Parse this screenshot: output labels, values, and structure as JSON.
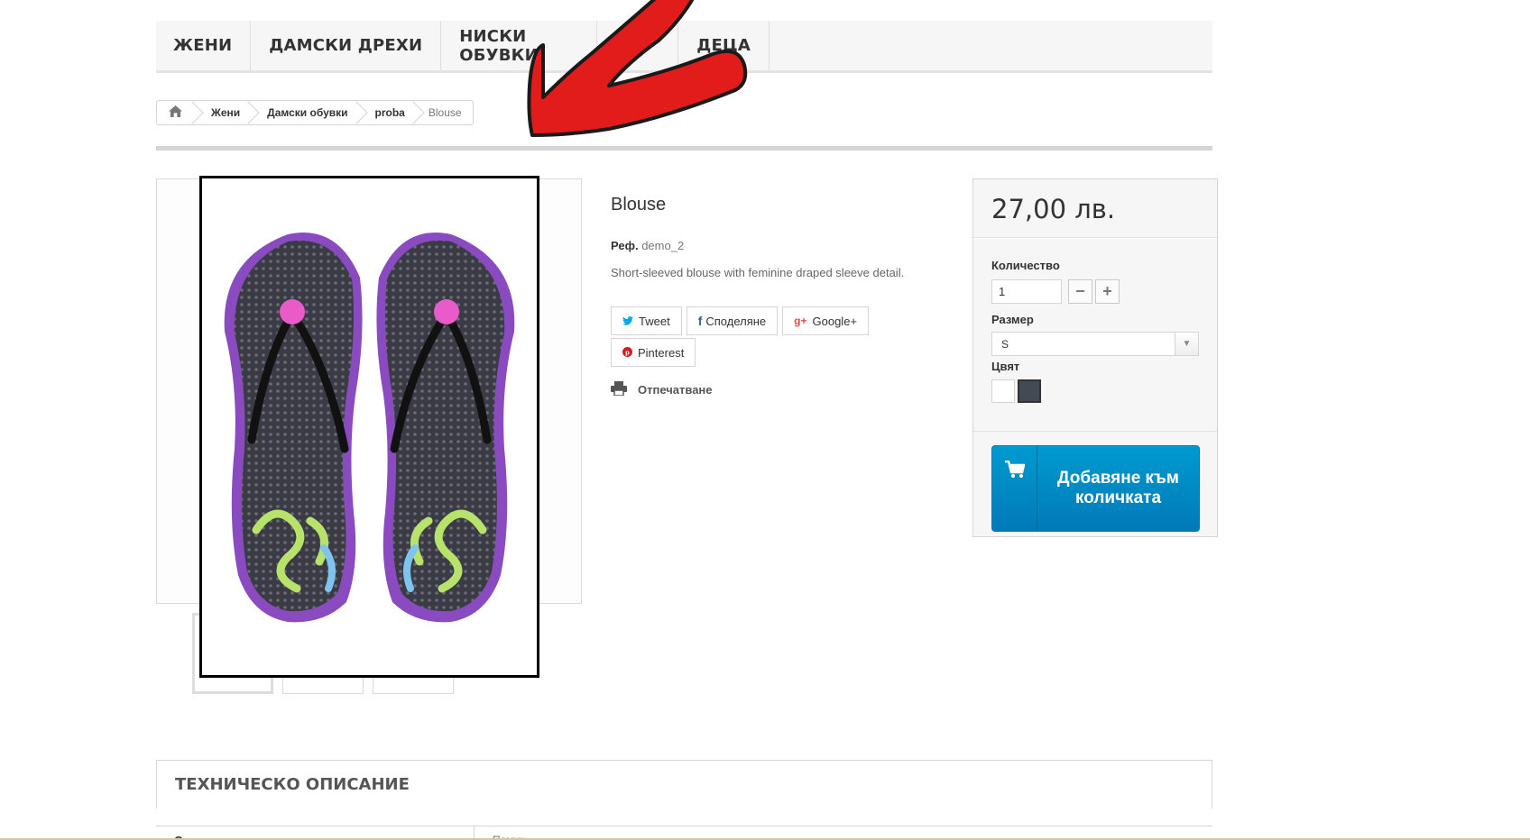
{
  "menu": {
    "items": [
      {
        "label": "ЖЕНИ"
      },
      {
        "label": "ДАМСКИ ДРЕХИ"
      },
      {
        "label": "НИСКИ ОБУВКИ"
      },
      {
        "label": "ДЕЦА"
      }
    ]
  },
  "breadcrumb": {
    "home_icon": "home-icon",
    "items": [
      {
        "label": "Жени"
      },
      {
        "label": "Дамски обувки"
      },
      {
        "label": "proba"
      }
    ],
    "current": "Blouse"
  },
  "product": {
    "title": "Blouse",
    "ref_label": "Реф.",
    "ref_value": "demo_2",
    "short_description": "Short-sleeved blouse with feminine draped sleeve detail.",
    "image_description": "purple flip-flops with floral print"
  },
  "social": {
    "tweet": "Tweet",
    "share": "Споделяне",
    "google": "Google+",
    "pinterest": "Pinterest"
  },
  "print": {
    "label": "Отпечатване"
  },
  "buy_box": {
    "price": "27,00 лв.",
    "quantity_label": "Количество",
    "quantity_value": "1",
    "size_label": "Размер",
    "size_value": "S",
    "color_label": "Цвят",
    "colors": [
      "#ffffff",
      "#434a54"
    ],
    "add_to_cart": "Добавяне към количката"
  },
  "tech": {
    "heading": "ТЕХНИЧЕСКО ОПИСАНИЕ",
    "rows": [
      {
        "name": "Състав",
        "value": "Памук"
      }
    ]
  },
  "colors": {
    "accent_blue": "#0096cf",
    "annotation_red": "#e21b1b"
  }
}
